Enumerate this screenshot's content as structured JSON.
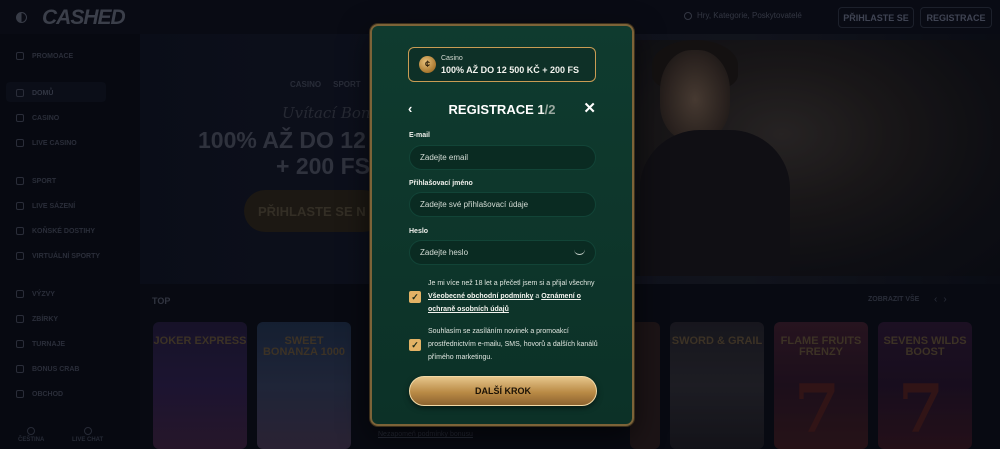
{
  "topbar": {
    "logo": "CASHED",
    "search_placeholder": "Hry, Kategorie, Poskytovatelé",
    "login_label": "PŘIHLASTE SE",
    "register_label": "REGISTRACE"
  },
  "sidebar": {
    "items": [
      {
        "label": "PROMOACE",
        "icon": "gift-icon"
      },
      {
        "label": "DOMŮ",
        "icon": "home-icon"
      },
      {
        "label": "CASINO",
        "icon": "casino-icon"
      },
      {
        "label": "LIVE CASINO",
        "icon": "live-casino-icon"
      },
      {
        "label": "SPORT",
        "icon": "sport-icon"
      },
      {
        "label": "LIVE SÁZENÍ",
        "icon": "live-betting-icon"
      },
      {
        "label": "KOŇSKÉ DOSTIHY",
        "icon": "horse-icon"
      },
      {
        "label": "VIRTUÁLNÍ SPORTY",
        "icon": "virtual-icon"
      },
      {
        "label": "VÝZVY",
        "icon": "challenge-icon"
      },
      {
        "label": "ZBÍRKY",
        "icon": "collection-icon"
      },
      {
        "label": "TURNAJE",
        "icon": "trophy-icon"
      },
      {
        "label": "BONUS CRAB",
        "icon": "crab-icon"
      },
      {
        "label": "OBCHOD",
        "icon": "shop-icon"
      }
    ],
    "footer": {
      "language": "ČEŠTINA",
      "chat": "LIVE CHAT"
    }
  },
  "hero": {
    "tabs": [
      "CASINO",
      "SPORT"
    ],
    "script": "Uvítací Bonus",
    "title_line1": "100% AŽ DO 12",
    "title_line2": "+ 200 FS",
    "button": "PŘIHLASTE SE N"
  },
  "games": {
    "section_label": "TOP",
    "see_all": "ZOBRAZIT VŠE",
    "tiles": [
      "JOKER EXPRESS",
      "SWEET BONANZA 1000",
      "SWORD & GRAIL",
      "FLAME FRUITS FRENZY",
      "SEVENS WILDS BOOST"
    ],
    "footer_link": "Nezapomeň podmínky bonusu"
  },
  "modal": {
    "bonus_label": "Casino",
    "bonus_value": "100% AŽ DO 12 500 KČ + 200 FS",
    "title": "REGISTRACE",
    "step": "1",
    "total": "/2",
    "email_label": "E-mail",
    "email_placeholder": "Zadejte email",
    "username_label": "Přihlašovací jméno",
    "username_placeholder": "Zadejte své přihlašovací údaje",
    "password_label": "Heslo",
    "password_placeholder": "Zadejte heslo",
    "terms_text_1": "Je mi více než 18 let a přečetl jsem si a přijal všechny",
    "terms_link_1": "Všeobecné obchodní podmínky",
    "terms_text_2": "a",
    "terms_link_2": "Oznámení o ochraně osobních údajů",
    "marketing_text": "Souhlasím se zasíláním novinek a promoakcí prostřednictvím e-mailu, SMS, hovorů a dalších kanálů přímého marketingu.",
    "next_button": "DALŠÍ KROK",
    "accent_color": "#e3b265",
    "panel_color": "#0f3b2f"
  }
}
